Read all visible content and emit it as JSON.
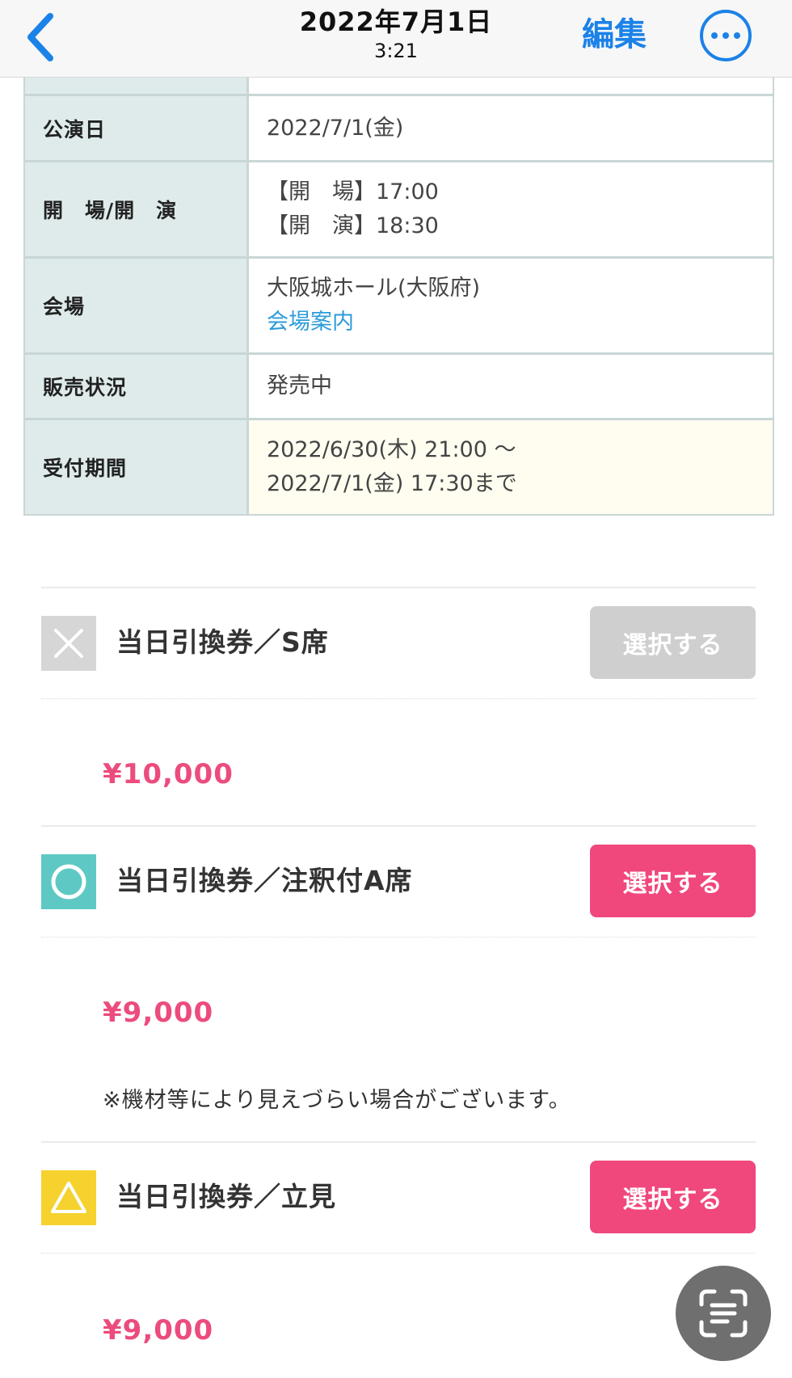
{
  "header": {
    "title_date": "2022年7月1日",
    "title_time": "3:21",
    "edit_label": "編集",
    "accent_color": "#1b82e8"
  },
  "info_table": {
    "performance_date_label": "公演日",
    "performance_date_value": "2022/7/1(金)",
    "open_start_label": "開　場/開　演",
    "open_time": "【開　場】17:00",
    "start_time": "【開　演】18:30",
    "venue_label": "会場",
    "venue_name": "大阪城ホール(大阪府)",
    "venue_link": "会場案内",
    "sales_status_label": "販売状況",
    "sales_status_value": "発売中",
    "reception_period_label": "受付期間",
    "reception_start": "2022/6/30(木) 21:00 〜",
    "reception_end": "2022/7/1(金) 17:30まで"
  },
  "tickets": [
    {
      "status_icon": "cross-icon",
      "name": "当日引換券／S席",
      "button_label": "選択する",
      "button_state": "disabled",
      "price": "¥10,000"
    },
    {
      "status_icon": "circle-icon",
      "name": "当日引換券／注釈付A席",
      "button_label": "選択する",
      "button_state": "active",
      "price": "¥9,000",
      "note": "※機材等により見えづらい場合がございます。"
    },
    {
      "status_icon": "triangle-icon",
      "name": "当日引換券／立見",
      "button_label": "選択する",
      "button_state": "active",
      "price": "¥9,000"
    }
  ],
  "colors": {
    "price_pink": "#ec4c7d",
    "button_pink": "#f0477c",
    "table_header_bg": "#deebea",
    "highlight_bg": "#fffdf0"
  }
}
